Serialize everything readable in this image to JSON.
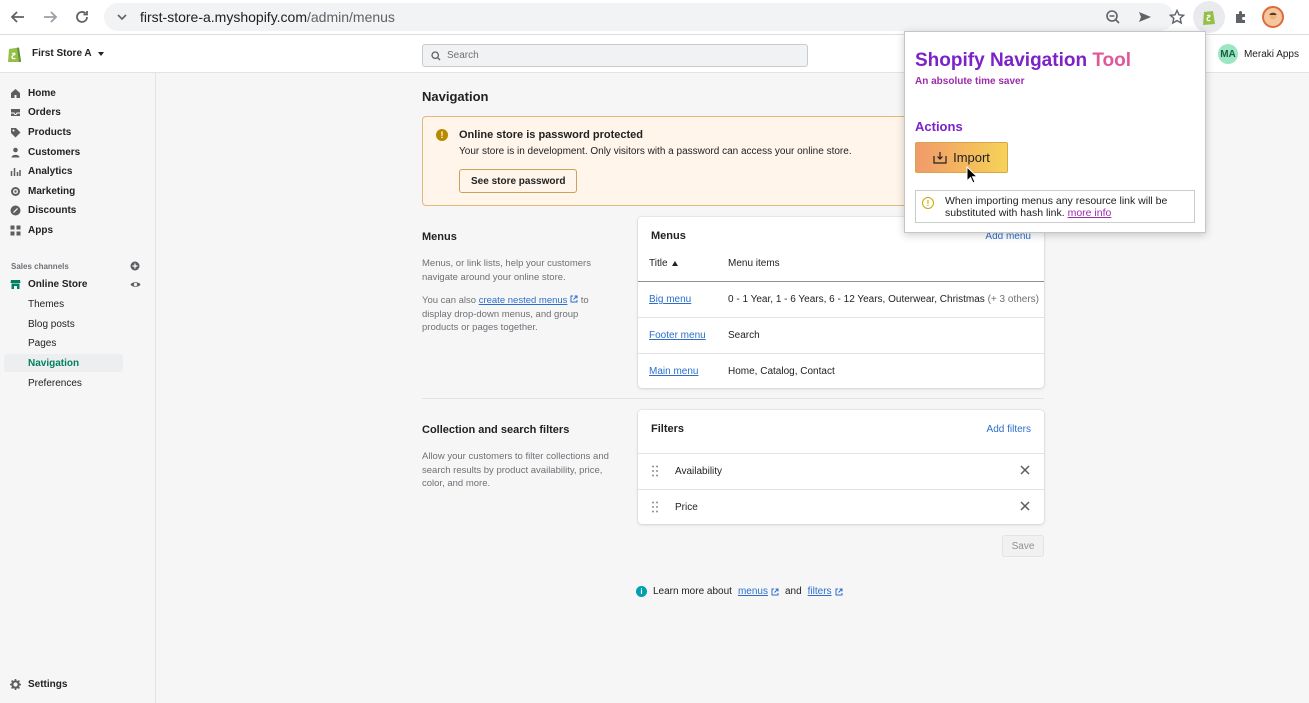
{
  "browser": {
    "url_host": "first-store-a.myshopify.com",
    "url_path": "/admin/menus"
  },
  "topbar": {
    "store_name": "First Store A",
    "search_placeholder": "Search",
    "user_initials": "MA",
    "user_name": "Meraki Apps"
  },
  "sidebar": {
    "items": [
      {
        "label": "Home",
        "icon": "home-icon"
      },
      {
        "label": "Orders",
        "icon": "orders-icon"
      },
      {
        "label": "Products",
        "icon": "tag-icon"
      },
      {
        "label": "Customers",
        "icon": "person-icon"
      },
      {
        "label": "Analytics",
        "icon": "bar-chart-icon"
      },
      {
        "label": "Marketing",
        "icon": "target-icon"
      },
      {
        "label": "Discounts",
        "icon": "discount-icon"
      },
      {
        "label": "Apps",
        "icon": "apps-icon"
      }
    ],
    "sales_channels_label": "Sales channels",
    "online_store_label": "Online Store",
    "sub_items": [
      "Themes",
      "Blog posts",
      "Pages",
      "Navigation",
      "Preferences"
    ],
    "active_sub": "Navigation",
    "settings_label": "Settings"
  },
  "main": {
    "page_title": "Navigation",
    "banner": {
      "title": "Online store is password protected",
      "description": "Your store is in development. Only visitors with a password can access your online store.",
      "button_label": "See store password"
    },
    "menus_section": {
      "title": "Menus",
      "desc1": "Menus, or link lists, help your customers navigate around your online store.",
      "desc2_pre": "You can also ",
      "desc2_link": "create nested menus",
      "desc2_post": " to display drop-down menus, and group products or pages together."
    },
    "menus_card": {
      "title": "Menus",
      "add_link": "Add menu",
      "col_title": "Title",
      "col_items": "Menu items",
      "rows": [
        {
          "title": "Big menu",
          "items": "0 - 1 Year, 1 - 6 Years, 6 - 12 Years, Outerwear, Christmas",
          "more": "(+ 3 others)"
        },
        {
          "title": "Footer menu",
          "items": "Search",
          "more": ""
        },
        {
          "title": "Main menu",
          "items": "Home, Catalog, Contact",
          "more": ""
        }
      ]
    },
    "filters_section": {
      "title": "Collection and search filters",
      "desc": "Allow your customers to filter collections and search results by product availability, price, color, and more."
    },
    "filters_card": {
      "title": "Filters",
      "add_link": "Add filters",
      "rows": [
        "Availability",
        "Price"
      ]
    },
    "save_label": "Save",
    "learn": {
      "pre": "Learn more about ",
      "link1": "menus",
      "mid": " and ",
      "link2": "filters"
    }
  },
  "popup": {
    "title_part1": "Shopify Navigation ",
    "title_part2": "Tool",
    "subtitle": "An absolute time saver",
    "actions_label": "Actions",
    "import_label": "Import",
    "note_text": "When importing menus any resource link will be substituted with hash link. ",
    "note_link": "more info"
  },
  "colors": {
    "shopify_green": "#008060",
    "link_blue": "#2c6ecb",
    "popup_purple": "#7b22c8",
    "popup_pink": "#e0579a",
    "banner_bg": "#fff5ea"
  }
}
